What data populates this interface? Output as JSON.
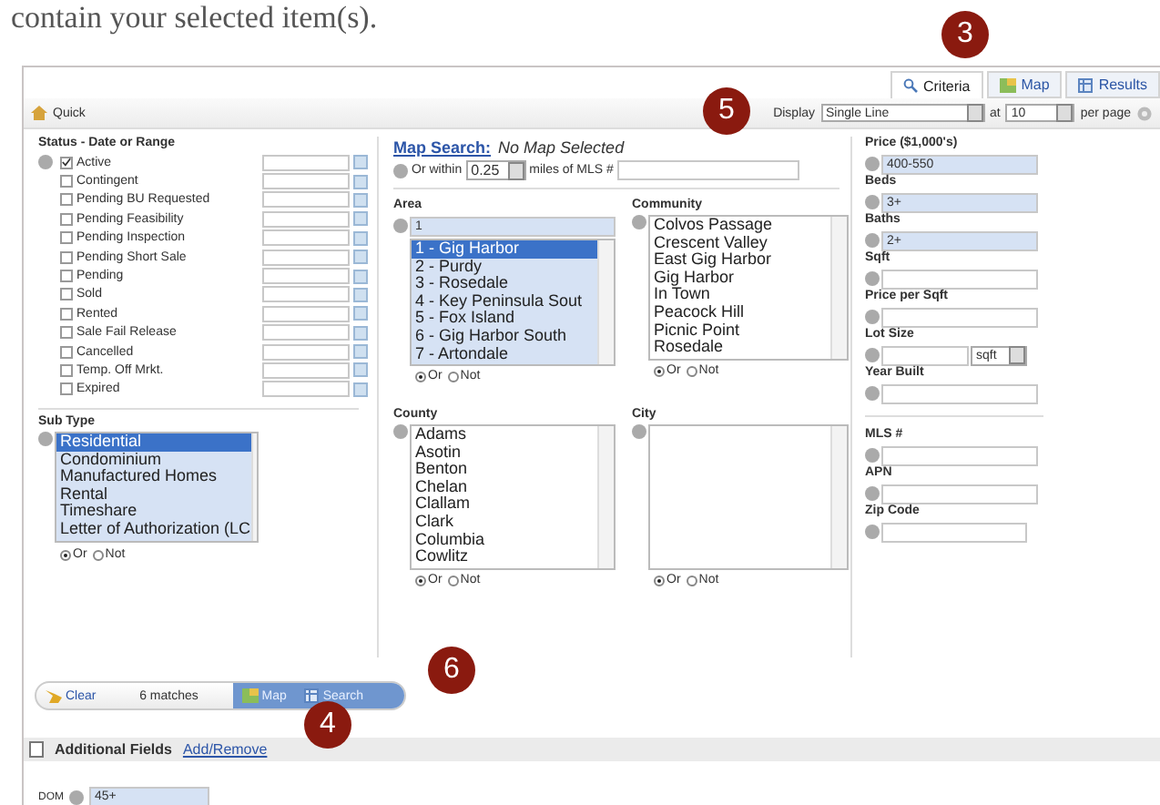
{
  "intro_text": "contain your selected item(s).",
  "tabs": [
    {
      "label": "Criteria",
      "kind": "search",
      "selected": true
    },
    {
      "label": "Map",
      "kind": "map",
      "selected": false
    },
    {
      "label": "Results",
      "kind": "grid",
      "selected": false
    }
  ],
  "toolbar": {
    "quick": "Quick",
    "display_label": "Display",
    "display_value": "Single Line",
    "at_label": "at",
    "per_page_value": "10",
    "per_page_label": "per page"
  },
  "status": {
    "title": "Status - Date or Range",
    "items": [
      {
        "label": "Active",
        "checked": true
      },
      {
        "label": "Contingent",
        "checked": false
      },
      {
        "label": "Pending BU Requested",
        "checked": false
      },
      {
        "label": "Pending Feasibility",
        "checked": false
      },
      {
        "label": "Pending Inspection",
        "checked": false
      },
      {
        "label": "Pending Short Sale",
        "checked": false
      },
      {
        "label": "Pending",
        "checked": false
      },
      {
        "label": "Sold",
        "checked": false
      },
      {
        "label": "Rented",
        "checked": false
      },
      {
        "label": "Sale Fail Release",
        "checked": false
      },
      {
        "label": "Cancelled",
        "checked": false
      },
      {
        "label": "Temp. Off Mrkt.",
        "checked": false
      },
      {
        "label": "Expired",
        "checked": false
      }
    ]
  },
  "sub_type": {
    "title": "Sub Type",
    "options": [
      {
        "label": "Residential",
        "selected": true
      },
      {
        "label": "Condominium",
        "selected": false
      },
      {
        "label": "Manufactured Homes",
        "selected": false
      },
      {
        "label": "Rental",
        "selected": false
      },
      {
        "label": "Timeshare",
        "selected": false
      },
      {
        "label": "Letter of Authorization (LC",
        "selected": false
      }
    ],
    "logic": [
      {
        "label": "Or",
        "selected": true
      },
      {
        "label": "Not",
        "selected": false
      }
    ]
  },
  "map_search": {
    "link": "Map Search:",
    "status": "No Map Selected",
    "within_label": "Or within",
    "within_value": "0.25",
    "miles_label": "miles of MLS #"
  },
  "area": {
    "title": "Area",
    "value": "1",
    "options": [
      {
        "label": "1 - Gig Harbor",
        "selected": true
      },
      {
        "label": "2 - Purdy",
        "selected": false
      },
      {
        "label": "3 - Rosedale",
        "selected": false
      },
      {
        "label": "4 - Key Peninsula Sout",
        "selected": false
      },
      {
        "label": "5 - Fox Island",
        "selected": false
      },
      {
        "label": "6 - Gig Harbor South",
        "selected": false
      },
      {
        "label": "7 - Artondale",
        "selected": false
      }
    ],
    "logic": [
      {
        "label": "Or",
        "selected": true
      },
      {
        "label": "Not",
        "selected": false
      }
    ]
  },
  "community": {
    "title": "Community",
    "options": [
      {
        "label": "Colvos Passage",
        "selected": false
      },
      {
        "label": "Crescent Valley",
        "selected": false
      },
      {
        "label": "East Gig Harbor",
        "selected": false
      },
      {
        "label": "Gig Harbor",
        "selected": false
      },
      {
        "label": "In Town",
        "selected": false
      },
      {
        "label": "Peacock Hill",
        "selected": false
      },
      {
        "label": "Picnic Point",
        "selected": false
      },
      {
        "label": "Rosedale",
        "selected": false
      }
    ],
    "logic": [
      {
        "label": "Or",
        "selected": true
      },
      {
        "label": "Not",
        "selected": false
      }
    ]
  },
  "county": {
    "title": "County",
    "options": [
      {
        "label": "Adams",
        "selected": false
      },
      {
        "label": "Asotin",
        "selected": false
      },
      {
        "label": "Benton",
        "selected": false
      },
      {
        "label": "Chelan",
        "selected": false
      },
      {
        "label": "Clallam",
        "selected": false
      },
      {
        "label": "Clark",
        "selected": false
      },
      {
        "label": "Columbia",
        "selected": false
      },
      {
        "label": "Cowlitz",
        "selected": false
      }
    ],
    "logic": [
      {
        "label": "Or",
        "selected": true
      },
      {
        "label": "Not",
        "selected": false
      }
    ]
  },
  "city": {
    "title": "City",
    "logic": [
      {
        "label": "Or",
        "selected": true
      },
      {
        "label": "Not",
        "selected": false
      }
    ]
  },
  "range_fields": [
    {
      "kind": "text",
      "label": "Price ($1,000's)",
      "value": "400-550"
    },
    {
      "kind": "text",
      "label": "Beds",
      "value": "3+"
    },
    {
      "kind": "text",
      "label": "Baths",
      "value": "2+"
    },
    {
      "kind": "text",
      "label": "Sqft"
    },
    {
      "kind": "text",
      "label": "Price per Sqft"
    },
    {
      "kind": "unit",
      "label": "Lot Size",
      "unit": "sqft"
    },
    {
      "kind": "text",
      "label": "Year Built"
    }
  ],
  "id_fields": [
    {
      "kind": "text",
      "label": "MLS #"
    },
    {
      "kind": "text",
      "label": "APN"
    },
    {
      "kind": "short",
      "label": "Zip Code"
    }
  ],
  "actions": {
    "clear": "Clear",
    "matches": "6 matches",
    "map": "Map",
    "search": "Search"
  },
  "additional": {
    "title": "Additional Fields",
    "link": "Add/Remove"
  },
  "extra_fields": [
    {
      "label": "DOM",
      "value": "45+"
    }
  ],
  "callouts": [
    {
      "number": "3",
      "kind": "tabs"
    },
    {
      "number": "5",
      "kind": "display"
    },
    {
      "number": "6",
      "kind": "actions"
    },
    {
      "number": "4",
      "kind": "additional"
    }
  ]
}
